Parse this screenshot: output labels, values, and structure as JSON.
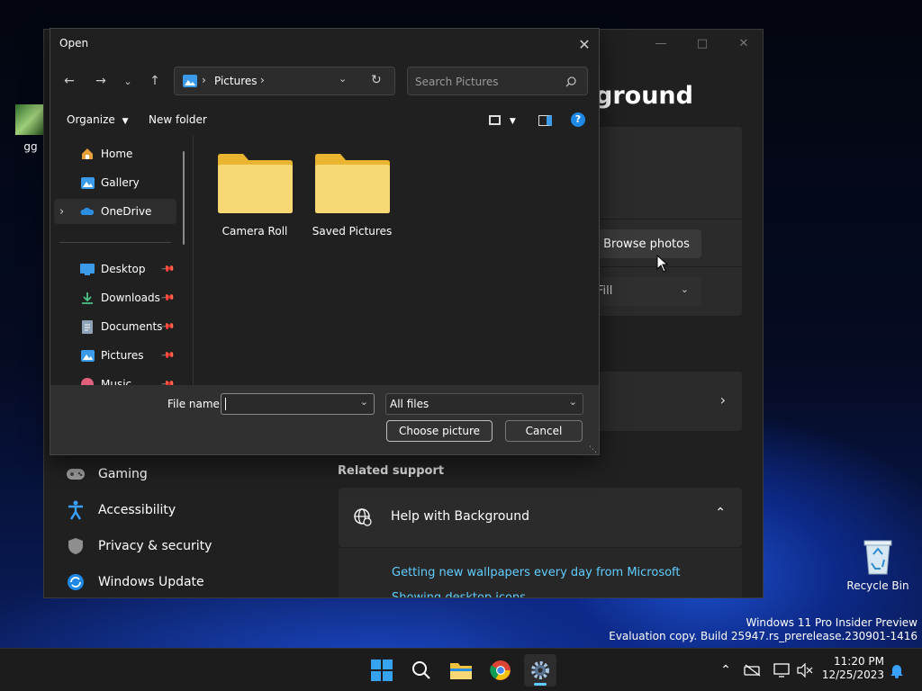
{
  "desktop": {
    "recycle_bin": "Recycle Bin",
    "left_icon_label": "gg",
    "watermark_line1": "Windows 11 Pro Insider Preview",
    "watermark_line2": "Evaluation copy. Build 25947.rs_prerelease.230901-1416"
  },
  "settings": {
    "page_title_fragment": "ground",
    "browse_photos": "Browse photos",
    "fit_value_fragment": "Fill",
    "related_support": "Related support",
    "help_with_background": "Help with Background",
    "link1": "Getting new wallpapers every day from Microsoft",
    "link2": "Showing desktop icons",
    "nav": [
      {
        "label": "Gaming",
        "icon": "gamepad-icon"
      },
      {
        "label": "Accessibility",
        "icon": "accessibility-icon"
      },
      {
        "label": "Privacy & security",
        "icon": "shield-icon"
      },
      {
        "label": "Windows Update",
        "icon": "update-icon"
      }
    ]
  },
  "dialog": {
    "title": "Open",
    "address": {
      "location": "Pictures"
    },
    "search_placeholder": "Search Pictures",
    "organize": "Organize",
    "new_folder": "New folder",
    "nav_items": [
      {
        "label": "Home",
        "icon": "home-icon"
      },
      {
        "label": "Gallery",
        "icon": "gallery-icon"
      },
      {
        "label": "OneDrive",
        "icon": "onedrive-icon"
      },
      {
        "label": "Desktop",
        "icon": "desktop-icon"
      },
      {
        "label": "Downloads",
        "icon": "download-icon"
      },
      {
        "label": "Documents",
        "icon": "document-icon"
      },
      {
        "label": "Pictures",
        "icon": "pictures-icon"
      },
      {
        "label": "Music",
        "icon": "music-icon"
      }
    ],
    "folders": [
      {
        "label": "Camera Roll"
      },
      {
        "label": "Saved Pictures"
      }
    ],
    "file_name_label": "File name:",
    "file_name_value": "",
    "file_type": "All files",
    "choose_button": "Choose picture",
    "cancel_button": "Cancel"
  },
  "taskbar": {
    "time": "11:20 PM",
    "date": "12/25/2023"
  },
  "colors": {
    "accent": "#0078d4",
    "link": "#60cdff",
    "folder": "#f8d775"
  }
}
